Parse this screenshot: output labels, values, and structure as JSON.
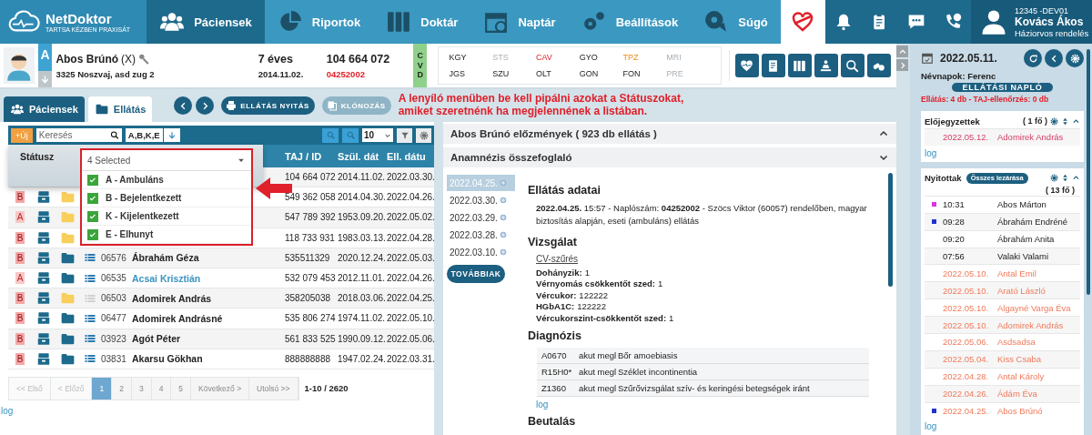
{
  "nav": {
    "logo": "NetDoktor",
    "tagline": "TARTSA KÉZBEN PRAXISÁT",
    "items": [
      {
        "label": "Páciensek",
        "selected": true
      },
      {
        "label": "Riportok",
        "selected": false
      },
      {
        "label": "Doktár",
        "selected": false
      },
      {
        "label": "Naptár",
        "selected": false
      },
      {
        "label": "Beállítások",
        "selected": false
      },
      {
        "label": "Súgó",
        "selected": false
      }
    ],
    "user": {
      "code": "12345 -DEV01",
      "name": "Kovács Ákos",
      "role": "Háziorvos rendelés"
    }
  },
  "patient": {
    "badge": "A",
    "name": "Abos Brúnó",
    "suffix": "(X)",
    "address": "3325 Noszvaj, asd zug 2",
    "age": "7 éves",
    "birth": "2014.11.02.",
    "taj": "104 664 072",
    "id": "04252002",
    "cvd": "CVD",
    "codes": [
      {
        "label": "KGY",
        "kind": "normal"
      },
      {
        "label": "STS",
        "kind": "off"
      },
      {
        "label": "CAV",
        "kind": "alert"
      },
      {
        "label": "GYO",
        "kind": "normal"
      },
      {
        "label": "TPZ",
        "kind": "warn"
      },
      {
        "label": "MRI",
        "kind": "off"
      },
      {
        "label": "JGS",
        "kind": "normal"
      },
      {
        "label": "SZU",
        "kind": "normal"
      },
      {
        "label": "OLT",
        "kind": "normal"
      },
      {
        "label": "GON",
        "kind": "normal"
      },
      {
        "label": "FON",
        "kind": "normal"
      },
      {
        "label": "PRE",
        "kind": "off"
      }
    ]
  },
  "toolbar": {
    "tabs": [
      {
        "label": "Páciensek",
        "selected": true
      },
      {
        "label": "Ellátás",
        "selected": false
      }
    ],
    "open_button": "ELLÁTÁS NYITÁS",
    "clone_button": {
      "label": "KLÓNOZÁS",
      "disabled": true
    },
    "note": "A lenyíló menüben be kell pipálni azokat a Státuszokat, amiket szeretnénk ha megjelennének a listában."
  },
  "patient_list": {
    "new_button": "+Új",
    "search": {
      "placeholder": "Keresés"
    },
    "status_filter": "A,B,K,E",
    "page_size": "10",
    "columns": [
      "TAJ / ID",
      "Szül. dát",
      "Ell. dátu"
    ],
    "status_label": "Státusz",
    "status_select": {
      "value": "4 Selected",
      "options": [
        {
          "label": "A - Ambuláns",
          "checked": true
        },
        {
          "label": "B - Bejelentkezett",
          "checked": true
        },
        {
          "label": "K - Kijelentkezett",
          "checked": true
        },
        {
          "label": "E - Elhunyt",
          "checked": true
        }
      ]
    },
    "rows": [
      {
        "taj": "104 664 072",
        "birth": "2014.11.02.",
        "visit": "2022.03.30."
      },
      {
        "status": "B",
        "empty": true,
        "taj": "549 362 058",
        "birth": "2014.04.30.",
        "visit": "2022.04.26."
      },
      {
        "status": "A",
        "empty": true,
        "taj": "547 789 392",
        "birth": "1953.09.20.",
        "visit": "2022.05.02."
      },
      {
        "status": "B",
        "empty": true,
        "taj": "118 733 931",
        "birth": "1983.03.13.",
        "visit": "2022.04.28."
      },
      {
        "status": "B",
        "empty": false,
        "id": "06576",
        "name": "Ábrahám Géza",
        "linked": false,
        "taj": "535511329",
        "birth": "2020.12.24.",
        "visit": "2022.05.03."
      },
      {
        "status": "A",
        "empty": false,
        "id": "06535",
        "name": "Acsai Krisztián",
        "linked": true,
        "taj": "532 079 453",
        "birth": "2012.11.01.",
        "visit": "2022.04.26."
      },
      {
        "status": "B",
        "empty": true,
        "id": "06503",
        "name": "Adomirek András",
        "linked": false,
        "taj": "358205038",
        "birth": "2018.03.06.",
        "visit": "2022.04.25."
      },
      {
        "status": "B",
        "empty": false,
        "id": "06477",
        "name": "Adomirek Andrásné",
        "linked": false,
        "taj": "535 806 274",
        "birth": "1974.11.02.",
        "visit": "2022.05.10."
      },
      {
        "status": "B",
        "empty": false,
        "id": "03923",
        "name": "Agót Péter",
        "linked": false,
        "taj": "561 833 525",
        "birth": "1990.09.12.",
        "visit": "2022.05.06."
      },
      {
        "status": "B",
        "empty": false,
        "id": "03831",
        "name": "Akarsu Gökhan",
        "linked": false,
        "taj": "888888888",
        "birth": "1947.02.24.",
        "visit": "2022.03.31."
      }
    ],
    "pagination": {
      "pages": [
        {
          "label": "<< Első",
          "disabled": true,
          "selected": false
        },
        {
          "label": "< Előző",
          "disabled": true,
          "selected": false
        },
        {
          "label": "1",
          "disabled": false,
          "selected": true
        },
        {
          "label": "2",
          "disabled": false,
          "selected": false
        },
        {
          "label": "3",
          "disabled": false,
          "selected": false
        },
        {
          "label": "4",
          "disabled": false,
          "selected": false
        },
        {
          "label": "5",
          "disabled": false,
          "selected": false
        },
        {
          "label": "Következő >",
          "disabled": false,
          "selected": false
        },
        {
          "label": "Utolsó >>",
          "disabled": false,
          "selected": false
        }
      ],
      "summary": "1-10 / 2620"
    },
    "log": "log"
  },
  "history": {
    "history_header": "Abos Brúnó előzmények ( 923 db ellátás )",
    "summary_header": "Anamnézis összefoglaló",
    "dates": [
      {
        "label": "2022.04.25.",
        "selected": true
      },
      {
        "label": "2022.03.30.",
        "selected": false
      },
      {
        "label": "2022.03.29.",
        "selected": false
      },
      {
        "label": "2022.03.28.",
        "selected": false
      },
      {
        "label": "2022.03.10.",
        "selected": false
      }
    ],
    "more_button": "TOVÁBBIAK",
    "care": {
      "title": "Ellátás adatai",
      "text": "**2022.04.25.** 15:57 - Naplószám: **04252002** - Szöcs Viktor (60057) rendelőben, magyar biztosítás alapján, eseti (ambuláns) ellátás"
    },
    "exam": {
      "title": "Vizsgálat",
      "link": "CV-szűrés",
      "fields": [
        {
          "label": "Dohányzik:",
          "value": "1"
        },
        {
          "label": "Vérnyomás csökkentőt szed:",
          "value": "1"
        },
        {
          "label": "Vércukor:",
          "value": "122222"
        },
        {
          "label": "HGbA1C:",
          "value": "122222"
        },
        {
          "label": "Vércukorszint-csökkentőt szed:",
          "value": "1"
        }
      ]
    },
    "diagnosis": {
      "title": "Diagnózis",
      "rows": [
        {
          "code": "A0670",
          "type": "akut megl",
          "text": "Bőr amoebiasis"
        },
        {
          "code": "R15H0*",
          "type": "akut megl",
          "text": "Széklet incontinentia"
        },
        {
          "code": "Z1360",
          "type": "akut megl",
          "text": "Szűrővizsgálat szív- és keringési betegségek iránt"
        }
      ]
    },
    "log": "log",
    "referral_title": "Beutalás"
  },
  "right": {
    "date": "2022.05.11.",
    "namedays": "Névnapok: Ferenc",
    "journal_button": "ELLÁTÁSI NAPLÓ",
    "summary": "Ellátás: 4 db - TAJ-ellenőrzés: 0 db",
    "booked": {
      "title": "Előjegyzettek",
      "count": "( 1 fő )",
      "rows": [
        {
          "time": "2022.05.12.",
          "name": "Adomirek András"
        }
      ],
      "log": "log"
    },
    "open": {
      "title": "Nyitottak",
      "close_all": "Összes lezárása",
      "count": "( 13 fő )",
      "rows": [
        {
          "time": "10:31",
          "name": "Abos Márton",
          "overdue": false,
          "color": "#dd33dd"
        },
        {
          "time": "09:28",
          "name": "Ábrahám Endréné",
          "overdue": false,
          "color": "#2233cc"
        },
        {
          "time": "09:20",
          "name": "Ábrahám Anita",
          "overdue": false
        },
        {
          "time": "07:56",
          "name": "Valaki Valami",
          "overdue": false
        },
        {
          "time": "2022.05.10.",
          "name": "Antal Emil",
          "overdue": true
        },
        {
          "time": "2022.05.10.",
          "name": "Arató László",
          "overdue": true
        },
        {
          "time": "2022.05.10.",
          "name": "Algayné Varga Éva",
          "overdue": true
        },
        {
          "time": "2022.05.10.",
          "name": "Adomirek András",
          "overdue": true
        },
        {
          "time": "2022.05.06.",
          "name": "Asdsadsa",
          "overdue": true
        },
        {
          "time": "2022.05.04.",
          "name": "Kiss Csaba",
          "overdue": true
        },
        {
          "time": "2022.04.28.",
          "name": "Antal Károly",
          "overdue": true
        },
        {
          "time": "2022.04.26.",
          "name": "Ádám Éva",
          "overdue": true
        },
        {
          "time": "2022.04.25.",
          "name": "Abos Brúnó",
          "overdue": true,
          "color": "#2233cc"
        }
      ],
      "log": "log"
    }
  }
}
